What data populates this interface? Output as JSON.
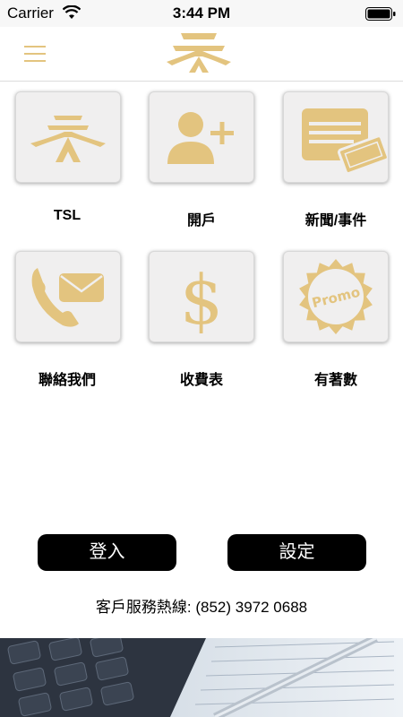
{
  "status_bar": {
    "carrier": "Carrier",
    "time": "3:44 PM"
  },
  "nav": {
    "menu_icon": "hamburger-menu-icon",
    "logo": "tsl-logo"
  },
  "tiles": [
    {
      "label": "TSL",
      "icon": "tsl-logo-icon"
    },
    {
      "label": "開戶",
      "icon": "add-user-icon"
    },
    {
      "label": "新聞/事件",
      "icon": "news-ticket-icon"
    },
    {
      "label": "聯絡我們",
      "icon": "phone-mail-icon"
    },
    {
      "label": "收費表",
      "icon": "dollar-icon"
    },
    {
      "label": "有著數",
      "icon": "promo-badge-icon",
      "badge_text": "Promo"
    }
  ],
  "buttons": {
    "login": "登入",
    "settings": "設定"
  },
  "hotline": "客戶服務熱線: (852) 3972 0688",
  "colors": {
    "accent_gold": "#e3c47f",
    "button_bg": "#000000",
    "tile_bg": "#f0efef"
  }
}
